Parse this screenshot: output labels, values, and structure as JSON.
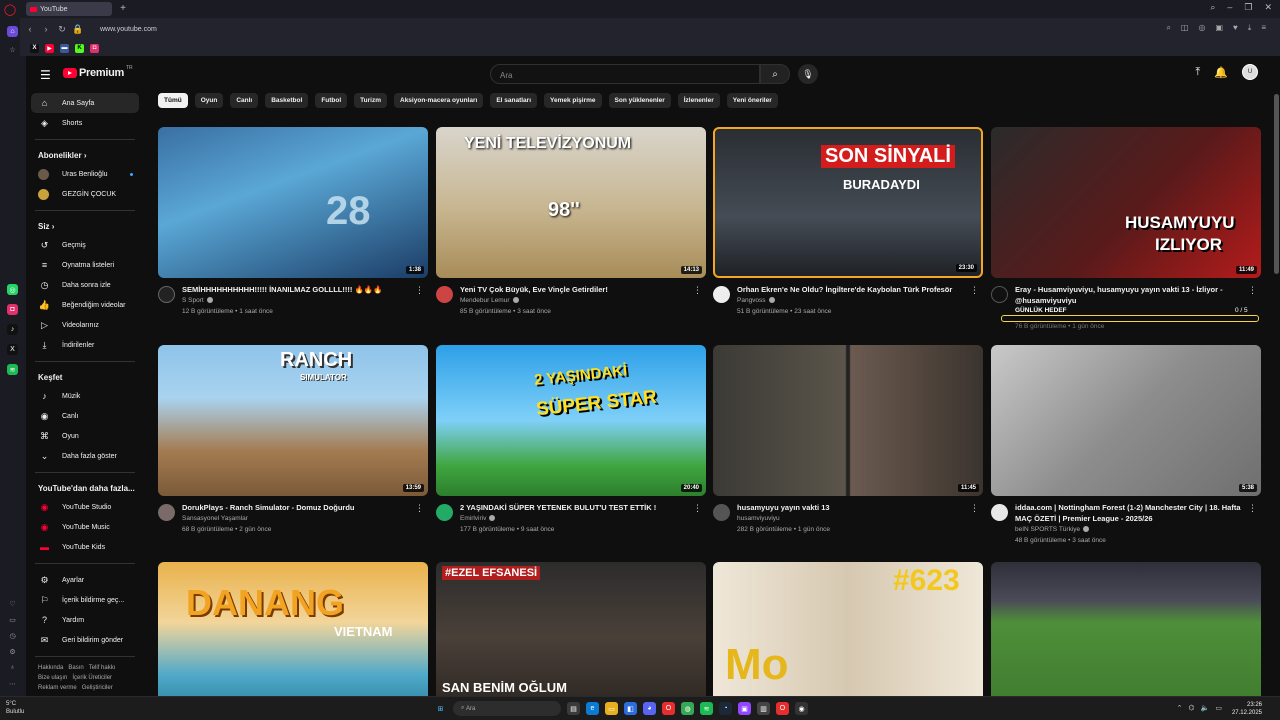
{
  "browser": {
    "tab_title": "YouTube",
    "url": "www.youtube.com"
  },
  "yt": {
    "logo_text": "Premium",
    "logo_badge": "TR",
    "search_placeholder": "Ara",
    "avatar_initials": "U"
  },
  "sidebar": {
    "main": [
      {
        "label": "Ana Sayfa",
        "icon": "home-icon",
        "glyph": "⌂"
      },
      {
        "label": "Shorts",
        "icon": "shorts-icon",
        "glyph": "◈"
      }
    ],
    "subs_heading": "Abonelikler",
    "subs": [
      {
        "label": "Uras Benlioğlu",
        "color": "#5a4a3a"
      },
      {
        "label": "GEZGİN ÇOCUK",
        "color": "#c8a23a"
      }
    ],
    "you_heading": "Siz",
    "you": [
      {
        "label": "Geçmiş",
        "glyph": "↺"
      },
      {
        "label": "Oynatma listeleri",
        "glyph": "≡"
      },
      {
        "label": "Daha sonra izle",
        "glyph": "◷"
      },
      {
        "label": "Beğendiğim videolar",
        "glyph": "👍"
      },
      {
        "label": "Videolarınız",
        "glyph": "▷"
      },
      {
        "label": "İndirilenler",
        "glyph": "⤓"
      }
    ],
    "explore_heading": "Keşfet",
    "explore": [
      {
        "label": "Müzik",
        "glyph": "♪"
      },
      {
        "label": "Canlı",
        "glyph": "◉"
      },
      {
        "label": "Oyun",
        "glyph": "⌘"
      },
      {
        "label": "Daha fazla göster",
        "glyph": "⌄"
      }
    ],
    "more_heading": "YouTube'dan daha fazla...",
    "more": [
      {
        "label": "YouTube Studio"
      },
      {
        "label": "YouTube Music"
      },
      {
        "label": "YouTube Kids"
      }
    ],
    "settings": [
      {
        "label": "Ayarlar",
        "glyph": "⚙"
      },
      {
        "label": "İçerik bildirme geç...",
        "glyph": "⚐"
      },
      {
        "label": "Yardım",
        "glyph": "?"
      },
      {
        "label": "Geri bildirim gönder",
        "glyph": "✉"
      }
    ],
    "footer1": [
      "Hakkında",
      "Basın",
      "Telif hakkı"
    ],
    "footer2": [
      "Bize ulaşın",
      "İçerik Üreticiler"
    ],
    "footer3": [
      "Reklam verme",
      "Geliştiriciler"
    ]
  },
  "chips": [
    "Tümü",
    "Oyun",
    "Canlı",
    "Basketbol",
    "Futbol",
    "Turizm",
    "Aksiyon-macera oyunları",
    "El sanatları",
    "Yemek pişirme",
    "Son yüklenenler",
    "İzlenenler",
    "Yeni öneriler"
  ],
  "videos": [
    {
      "title": "SEMİHHHHHHHHHH!!!!! İNANILMAZ GOLLLL!!!! 🔥🔥🔥",
      "channel": "S Sport",
      "meta": "12 B görüntüleme • 1 saat önce",
      "duration": "1:38"
    },
    {
      "title": "Yeni TV Çok Büyük, Eve Vinçle Getirdiler!",
      "channel": "Mendebur Lemur",
      "meta": "85 B görüntüleme • 3 saat önce",
      "duration": "14:13",
      "overlay1": "YENİ TELEVİZYONUM",
      "overlay2": "98''"
    },
    {
      "title": "Orhan Ekren'e Ne Oldu? İngiltere'de Kaybolan Türk Profesör",
      "channel": "Pangvoss",
      "meta": "51 B görüntüleme • 23 saat önce",
      "duration": "23:30",
      "overlay1": "SON SİNYALİ",
      "overlay2": "BURADAYDI"
    },
    {
      "title": "Eray - Husamviyuviyu, husamyuyu yayın vakti 13 - İzliyor -",
      "title2": "@husamviyuviyu",
      "channel": "GÜNLÜK HEDEF",
      "meta": "76 B görüntüleme • 1 gün önce",
      "duration": "11:49",
      "overlay1": "HUSAMYUYU",
      "overlay2": "IZLIYOR",
      "goal": "0 / 5"
    },
    {
      "title": "DorukPlays - Ranch Simulator - Domuz Doğurdu",
      "channel": "Sansasyonel Yaşamlar",
      "meta": "68 B görüntüleme • 2 gün önce",
      "duration": "13:59",
      "overlay1": "RANCH",
      "overlay2": "SIMULATOR"
    },
    {
      "title": "2 YAŞINDAKİ SÜPER YETENEK BULUT'U TEST ETTİK !",
      "channel": "Emirlviriv",
      "meta": "177 B görüntüleme • 9 saat önce",
      "duration": "20:40",
      "overlay1": "2 YAŞINDAKİ",
      "overlay2": "SÜPER STAR"
    },
    {
      "title": "husamyuyu yayın vakti 13",
      "channel": "husamviyuviyu",
      "meta": "282 B görüntüleme • 1 gün önce",
      "duration": "11:45"
    },
    {
      "title": "iddaa.com | Nottingham Forest (1-2) Manchester City | 18. Hafta",
      "title2": "MAÇ ÖZETİ | Premier League - 2025/26",
      "channel": "beIN SPORTS Türkiye",
      "meta": "48 B görüntüleme • 3 saat önce",
      "duration": "5:38"
    },
    {
      "title": "",
      "channel": "",
      "meta": "",
      "overlay1": "DANANG",
      "overlay2": "VIETNAM"
    },
    {
      "title": "",
      "channel": "",
      "meta": "",
      "overlay1": "#EZEL EFSANESİ",
      "overlay2": "SAN BENİM OĞLUM"
    },
    {
      "title": "",
      "channel": "",
      "meta": "",
      "overlay1": "#623",
      "overlay2": "Mo"
    },
    {
      "title": "",
      "channel": "",
      "meta": ""
    }
  ],
  "taskbar": {
    "temp": "5°C",
    "weather": "Bulutlu",
    "search": "Ara",
    "time": "23:26",
    "date": "27.12.2025"
  }
}
